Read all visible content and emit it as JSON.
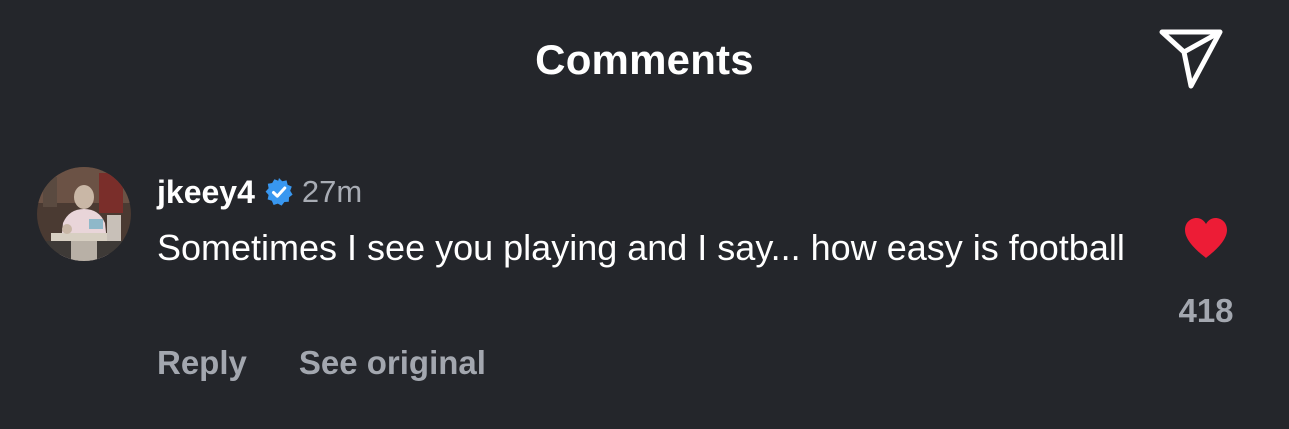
{
  "header": {
    "title": "Comments",
    "share_icon": "send-icon"
  },
  "comment": {
    "username": "jkeey4",
    "verified": true,
    "timestamp": "27m",
    "text": "Sometimes I see you playing and I say... how easy is football",
    "actions": {
      "reply_label": "Reply",
      "see_original_label": "See original"
    },
    "likes": {
      "count": "418",
      "liked": true,
      "icon": "heart-icon"
    }
  },
  "colors": {
    "background": "#24262b",
    "text_primary": "#ffffff",
    "text_secondary": "#a3a7af",
    "verified_badge": "#3897f0",
    "like_heart": "#ed1c36"
  }
}
